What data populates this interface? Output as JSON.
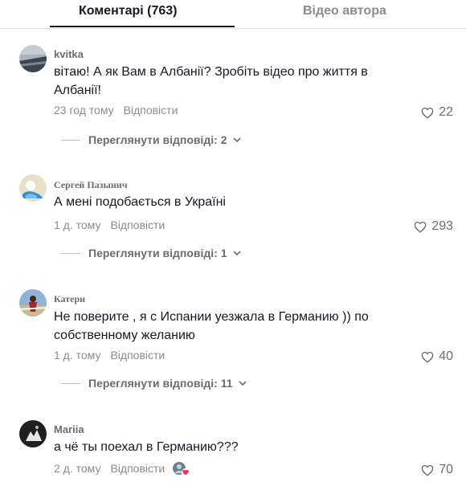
{
  "tabs": {
    "comments": "Коментарі (763)",
    "author_videos": "Відео автора"
  },
  "comments": [
    {
      "username": "kvitka",
      "text": "вітаю! А як Вам в Албанії? Зробіть відео про життя в Албанії!",
      "time": "23 год тому",
      "reply": "Відповісти",
      "likes": "22",
      "view_replies": "Переглянути відповіді: 2"
    },
    {
      "username": "Сергей Пазынич",
      "text": "А мені подобається в Україні",
      "time": "1 д. тому",
      "reply": "Відповісти",
      "likes": "293",
      "view_replies": "Переглянути відповіді: 1"
    },
    {
      "username": "Катери",
      "text": "Не поверите , я с Испании уезжала в Германию )) по собственному желанию",
      "time": "1 д. тому",
      "reply": "Відповісти",
      "likes": "40",
      "view_replies": "Переглянути відповіді: 11"
    },
    {
      "username": "Mariia",
      "text": "а чё ты поехал в Германию???",
      "time": "2 д. тому",
      "reply": "Відповісти",
      "likes": "70"
    }
  ],
  "colors": {
    "primary_text": "#161823",
    "secondary_text": "#8a8b91",
    "heart_badge": "#fe2c55"
  },
  "icons": {
    "like": "heart-outline-icon",
    "expand": "chevron-down-icon",
    "creator_like": "creator-liked-heart-badge"
  }
}
